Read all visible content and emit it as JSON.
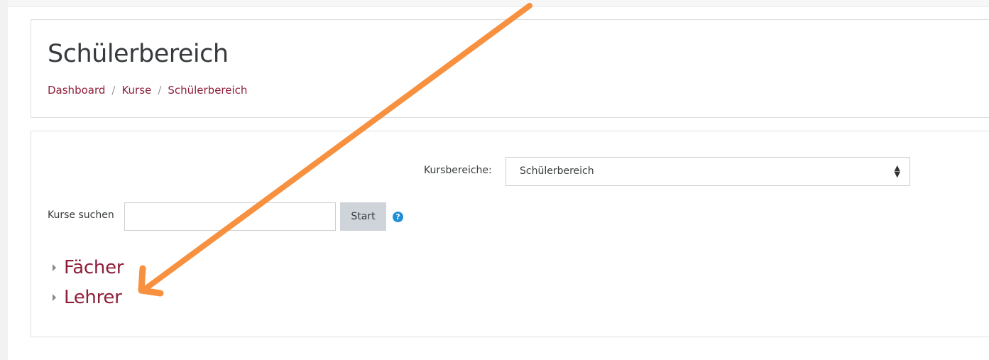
{
  "header": {
    "title": "Schülerbereich",
    "breadcrumb": [
      {
        "label": "Dashboard"
      },
      {
        "label": "Kurse"
      },
      {
        "label": "Schülerbereich"
      }
    ],
    "separator": "/"
  },
  "category_selector": {
    "label": "Kursbereiche:",
    "selected": "Schülerbereich"
  },
  "search": {
    "label": "Kurse suchen",
    "value": "",
    "button_label": "Start",
    "help_icon": "question-circle-icon"
  },
  "categories": [
    {
      "name": "Fächer"
    },
    {
      "name": "Lehrer"
    }
  ],
  "annotation": {
    "color": "#f7913f"
  },
  "colors": {
    "link": "#8f1f3b",
    "help": "#1f8fd6"
  }
}
